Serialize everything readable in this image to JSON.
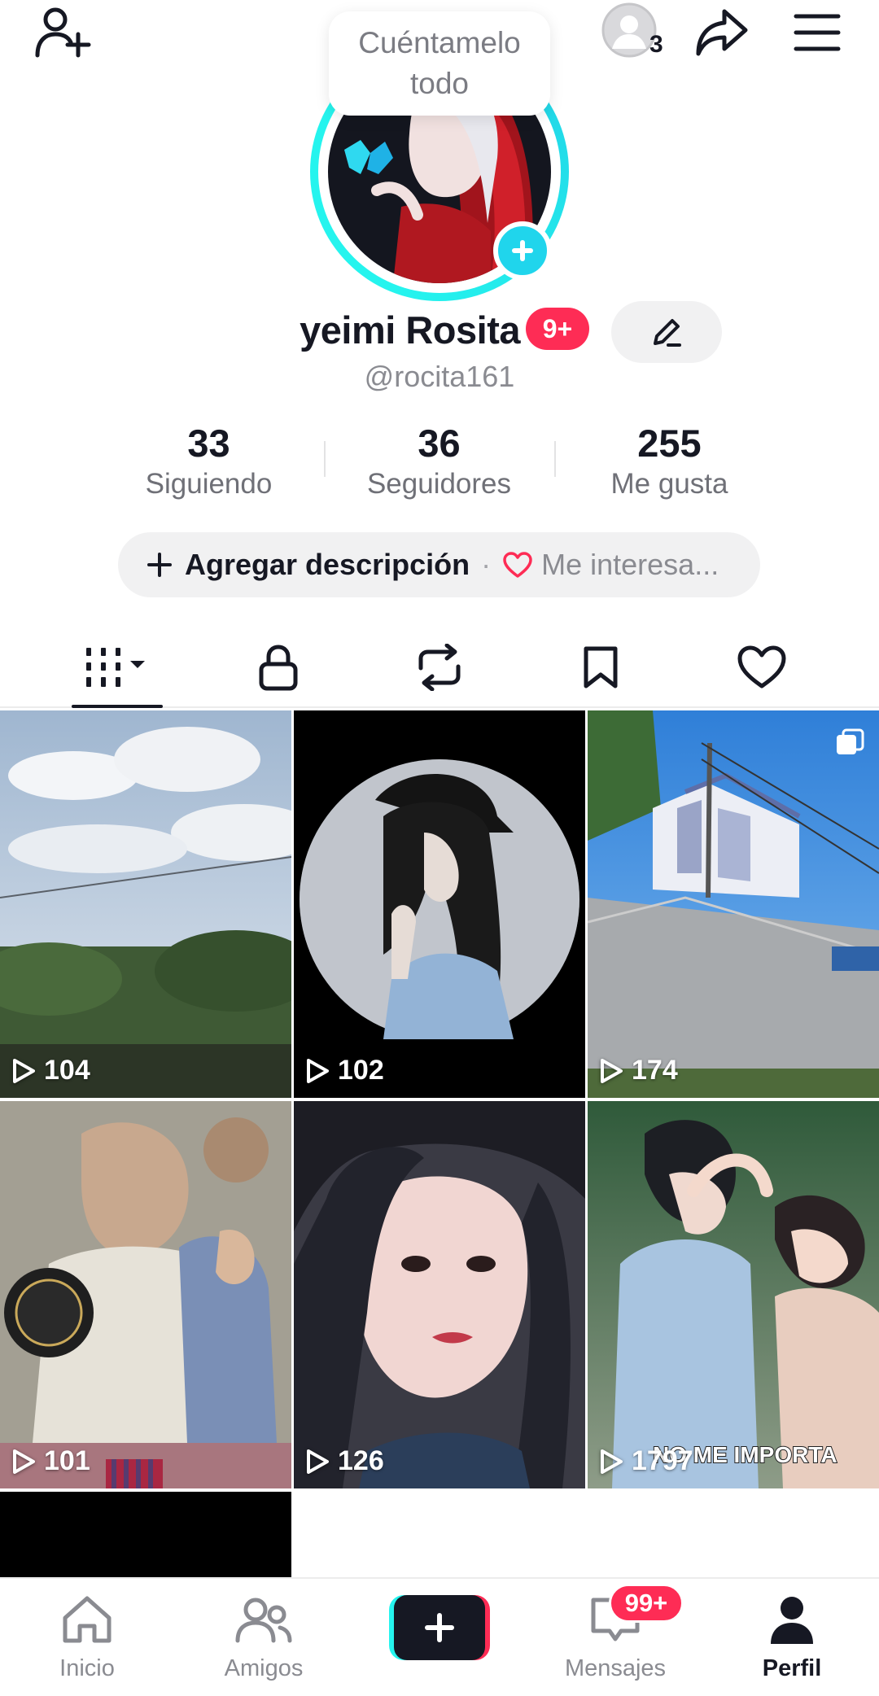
{
  "header": {
    "viewers_count": "3",
    "note_bubble": "Cuéntamelo todo"
  },
  "profile": {
    "display_name": "yeimi Rosita",
    "name_badge": "9+",
    "handle": "@rocita161"
  },
  "stats": [
    {
      "value": "33",
      "label": "Siguiendo"
    },
    {
      "value": "36",
      "label": "Seguidores"
    },
    {
      "value": "255",
      "label": "Me gusta"
    }
  ],
  "description_pill": {
    "add_label": "Agregar descripción",
    "separator": "·",
    "interests_label": "Me interesa..."
  },
  "tabs": [
    {
      "icon": "grid-icon",
      "active": true
    },
    {
      "icon": "lock-icon",
      "active": false
    },
    {
      "icon": "repost-icon",
      "active": false
    },
    {
      "icon": "bookmark-icon",
      "active": false
    },
    {
      "icon": "heart-icon",
      "active": false
    }
  ],
  "videos": [
    {
      "views": "104",
      "thumbnail": "sky-and-field"
    },
    {
      "views": "102",
      "thumbnail": "girl-in-cap"
    },
    {
      "views": "174",
      "thumbnail": "street-church",
      "multi": true
    },
    {
      "views": "101",
      "thumbnail": "family-photo"
    },
    {
      "views": "126",
      "thumbnail": "crying-girl"
    },
    {
      "views": "1797",
      "thumbnail": "couple",
      "caption": "NO ME IMPORTA"
    },
    {
      "views": "",
      "thumbnail": "black"
    }
  ],
  "bottom_nav": {
    "home": "Inicio",
    "friends": "Amigos",
    "messages": "Mensajes",
    "messages_badge": "99+",
    "profile": "Perfil"
  },
  "colors": {
    "accent_red": "#fe2c55",
    "accent_cyan": "#25f4ee",
    "text_primary": "#161823",
    "text_secondary": "#8a8b91"
  }
}
